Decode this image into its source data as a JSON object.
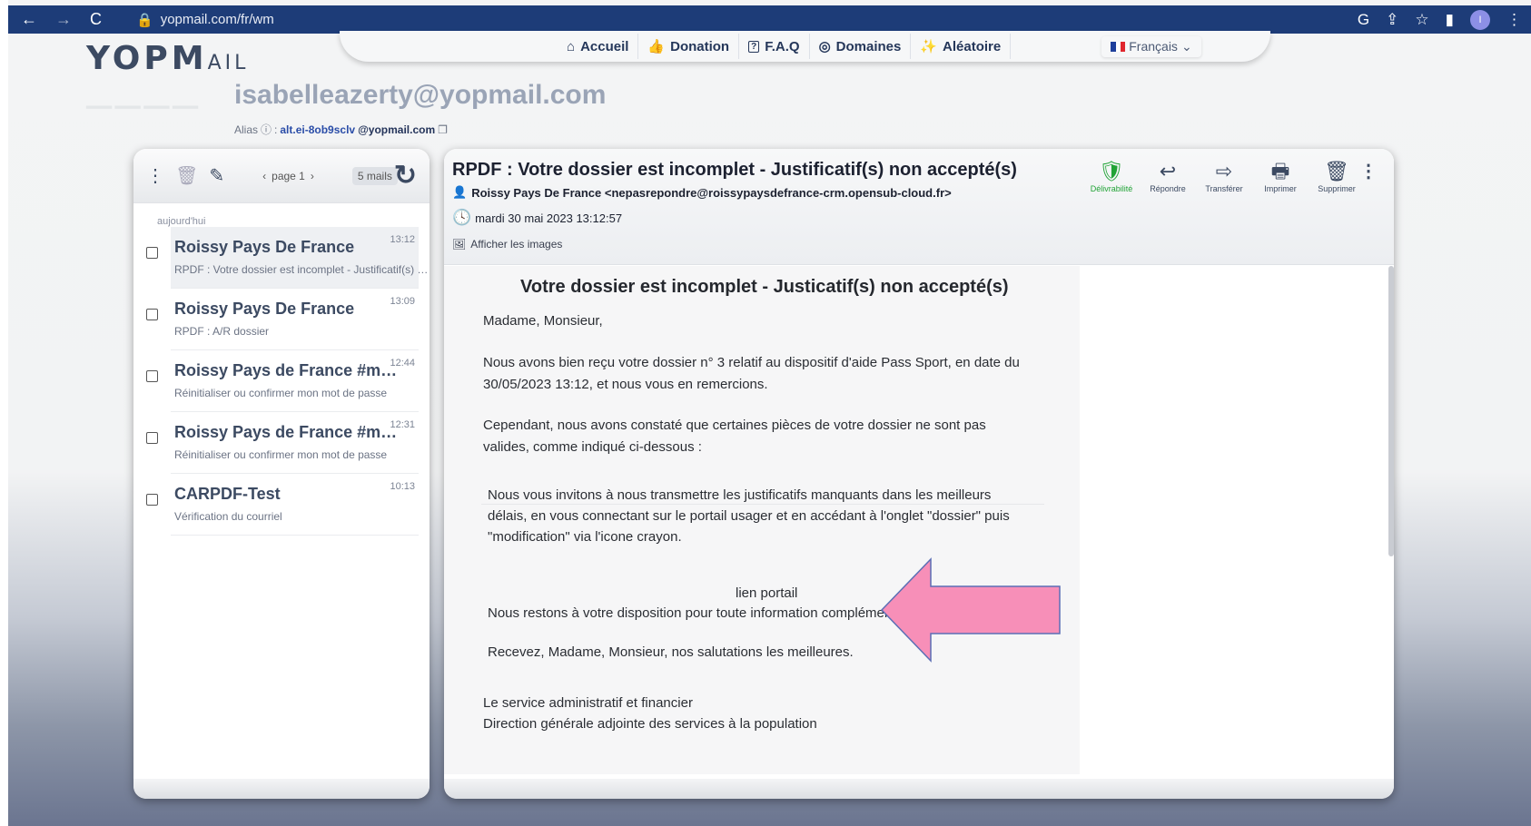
{
  "browser": {
    "url": "yopmail.com/fr/wm",
    "nav": {
      "back": "←",
      "forward": "→",
      "reload": "C"
    },
    "profile_initial": "I"
  },
  "logo": {
    "big": "YOPM",
    "small": "AIL"
  },
  "topnav": {
    "items": [
      {
        "icon": "⌂",
        "label": "Accueil"
      },
      {
        "icon": "👍",
        "label": "Donation"
      },
      {
        "icon": "?",
        "label": "F.A.Q"
      },
      {
        "icon": "◎",
        "label": "Domaines"
      },
      {
        "icon": "✨",
        "label": "Aléatoire"
      }
    ],
    "language": "Français",
    "flag_colors": [
      "#1e3f9b",
      "#ffffff",
      "#e0262e"
    ]
  },
  "account": {
    "email": "isabelleazerty@yopmail.com",
    "alias_label": "Alias",
    "alias_local": "alt.ei-8ob9sclv",
    "alias_domain": "@yopmail.com"
  },
  "inbox": {
    "page": "page 1",
    "count": "5 mails",
    "day": "aujourd'hui",
    "mails": [
      {
        "from": "Roissy Pays De France",
        "time": "13:12",
        "subject": "RPDF : Votre dossier est incomplet - Justificatif(s) non accepté(s)"
      },
      {
        "from": "Roissy Pays De France",
        "time": "13:09",
        "subject": "RPDF : A/R dossier"
      },
      {
        "from": "Roissy Pays de France #mot de passe",
        "time": "12:44",
        "subject": "Réinitialiser ou confirmer mon mot de passe"
      },
      {
        "from": "Roissy Pays de France #mot de passe",
        "time": "12:31",
        "subject": "Réinitialiser ou confirmer mon mot de passe"
      },
      {
        "from": "CARPDF-Test",
        "time": "10:13",
        "subject": "Vérification du courriel"
      }
    ]
  },
  "message": {
    "subject": "RPDF : Votre dossier est incomplet - Justificatif(s) non accepté(s)",
    "from": "Roissy Pays De France <nepasrepondre@roissypaysdefrance-crm.opensub-cloud.fr>",
    "date": "mardi 30 mai 2023 13:12:57",
    "show_images": "Afficher les images",
    "actions": {
      "deliverability": "Délivrabilité",
      "reply": "Répondre",
      "forward": "Transférer",
      "print": "Imprimer",
      "delete": "Supprimer"
    },
    "body": {
      "title": "Votre dossier est incomplet - Justicatif(s) non accepté(s)",
      "greeting": "Madame, Monsieur,",
      "p1": "Nous avons bien reçu votre dossier n° 3 relatif au dispositif d'aide Pass Sport, en date du 30/05/2023 13:12, et nous vous en remercions.",
      "p2": "Cependant, nous avons constaté que certaines pièces de votre dossier ne sont pas valides, comme indiqué ci-dessous :",
      "p3": "Nous vous invitons à nous transmettre les justificatifs manquants dans les meilleurs délais, en vous connectant sur le portail usager et en accédant à l'onglet \"dossier\" puis \"modification\" via l'icone crayon.",
      "link": "lien portail",
      "p4": "Nous restons à votre disposition pour toute information complémentaire.",
      "p5": "Recevez, Madame, Monsieur, nos salutations les meilleures.",
      "sig1": "Le service administratif et financier",
      "sig2": "Direction générale adjointe des services à la population"
    }
  },
  "annotation": {
    "arrow_color": "#f78fb8"
  }
}
